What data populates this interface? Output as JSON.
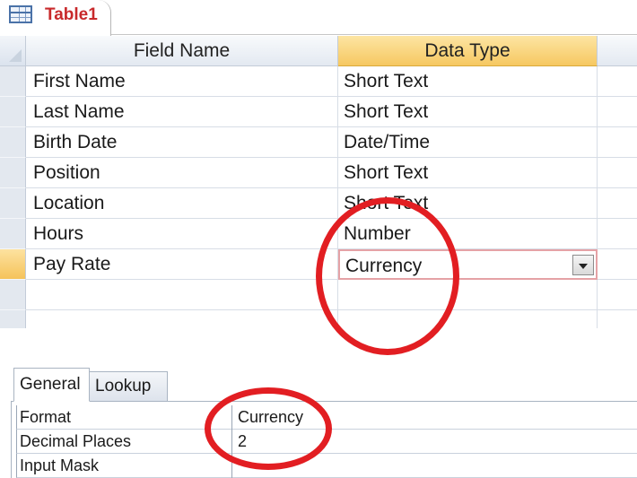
{
  "document_tab": {
    "title": "Table1",
    "icon": "table-icon"
  },
  "grid": {
    "headers": {
      "field_name": "Field Name",
      "data_type": "Data Type"
    },
    "rows": [
      {
        "field_name": "First Name",
        "data_type": "Short Text"
      },
      {
        "field_name": "Last Name",
        "data_type": "Short Text"
      },
      {
        "field_name": "Birth Date",
        "data_type": "Date/Time"
      },
      {
        "field_name": "Position",
        "data_type": "Short Text"
      },
      {
        "field_name": "Location",
        "data_type": "Short Text"
      },
      {
        "field_name": "Hours",
        "data_type": "Number"
      },
      {
        "field_name": "Pay Rate",
        "data_type": "Currency"
      }
    ],
    "active_row_index": 6
  },
  "field_properties": {
    "tabs": [
      "General",
      "Lookup"
    ],
    "active_tab": "General",
    "properties": [
      {
        "label": "Format",
        "value": "Currency"
      },
      {
        "label": "Decimal Places",
        "value": "2"
      },
      {
        "label": "Input Mask",
        "value": ""
      }
    ]
  },
  "colors": {
    "annotation": "#e21e22",
    "tab_title": "#c8292b",
    "active_header": "#f6c861"
  }
}
